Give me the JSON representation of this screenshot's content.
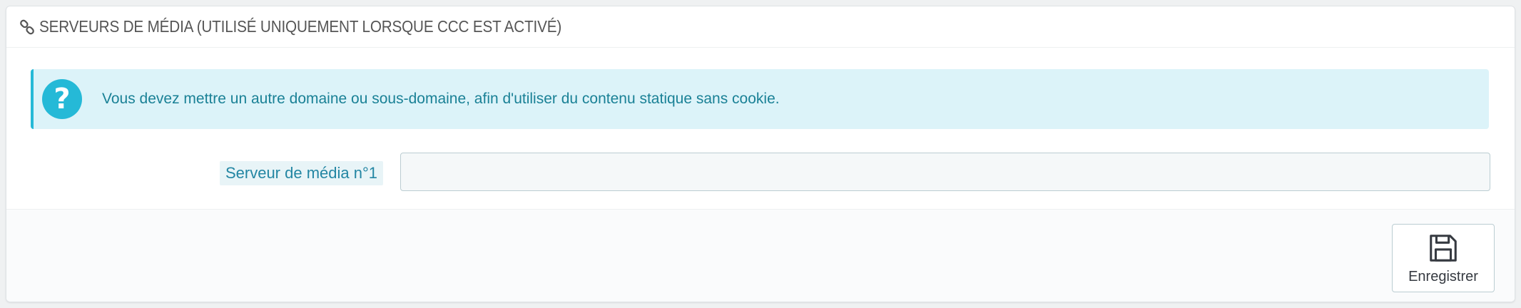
{
  "panel": {
    "title": "SERVEURS DE MÉDIA (UTILISÉ UNIQUEMENT LORSQUE CCC EST ACTIVÉ)",
    "title_icon": "link-icon"
  },
  "alert": {
    "icon": "help-icon",
    "icon_glyph": "?",
    "text": "Vous devez mettre un autre domaine ou sous-domaine, afin d'utiliser du contenu statique sans cookie."
  },
  "form": {
    "media_server_1": {
      "label": "Serveur de média n°1",
      "value": "",
      "placeholder": ""
    }
  },
  "footer": {
    "save_label": "Enregistrer",
    "save_icon": "save-icon"
  },
  "colors": {
    "accent": "#25b9d7",
    "alert_bg": "#dcf3f9",
    "alert_text": "#1a8196",
    "label_text": "#2386a3"
  }
}
